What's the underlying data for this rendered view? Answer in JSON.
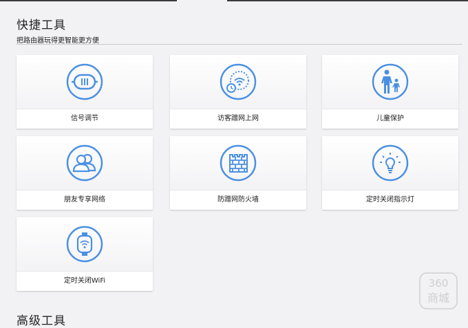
{
  "section": {
    "title": "快捷工具",
    "subtitle": "把路由器玩得更智能更方便"
  },
  "tools": [
    {
      "label": "信号调节",
      "icon": "signal-adjust-icon"
    },
    {
      "label": "访客蹭网上网",
      "icon": "guest-wifi-icon"
    },
    {
      "label": "儿童保护",
      "icon": "child-protection-icon"
    },
    {
      "label": "朋友专享网络",
      "icon": "friends-network-icon"
    },
    {
      "label": "防蹭网防火墙",
      "icon": "firewall-icon"
    },
    {
      "label": "定时关闭指示灯",
      "icon": "light-bulb-icon"
    },
    {
      "label": "定时关闭WiFi",
      "icon": "wifi-watch-icon"
    }
  ],
  "next_section": {
    "title": "高级工具"
  },
  "watermark": {
    "line1": "360",
    "line2": "商城"
  },
  "colors": {
    "accent": "#4a90e2",
    "background": "#f2f2f4",
    "text": "#222222"
  }
}
